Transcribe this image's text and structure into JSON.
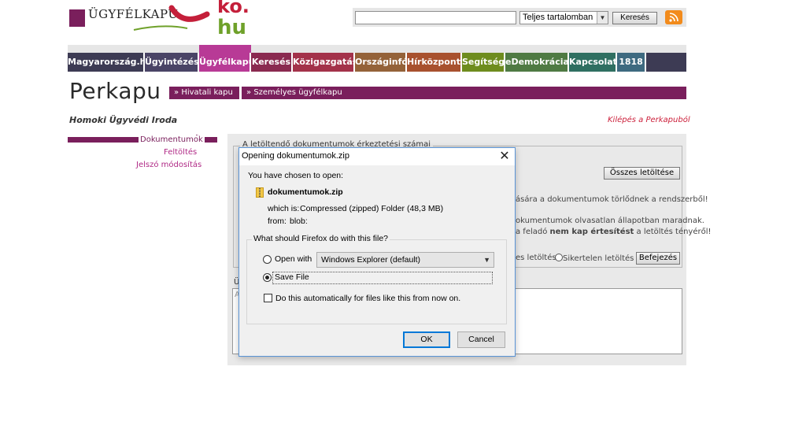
{
  "header": {
    "logo_text": "ÜGYFÉLKAPU",
    "search": {
      "value": "",
      "placeholder": ""
    },
    "scope_select": "Teljes tartalomban",
    "search_button": "Keresés"
  },
  "nav": {
    "items": [
      {
        "label": "Magyarország.hu",
        "color": "#3d3b54"
      },
      {
        "label": "Ügyintézés",
        "color": "#4a4466"
      },
      {
        "label": "Ügyfélkapu",
        "color": "#b83a96"
      },
      {
        "label": "Keresés",
        "color": "#8a2a50"
      },
      {
        "label": "Közigazgatás",
        "color": "#a3324a"
      },
      {
        "label": "Országinfó",
        "color": "#946239"
      },
      {
        "label": "Hírközpont",
        "color": "#a8512e"
      },
      {
        "label": "Segítség",
        "color": "#6e8c1e"
      },
      {
        "label": "eDemokrácia",
        "color": "#4f7a43"
      },
      {
        "label": "Kapcsolat",
        "color": "#2f6f61"
      },
      {
        "label": "1818",
        "color": "#3e6a80"
      }
    ]
  },
  "page": {
    "title": "Perkapu",
    "tabs": [
      "Hivatali kapu",
      "Személyes ügyfélkapu"
    ],
    "org_name": "Homoki Ügyvédi Iroda",
    "logout": "Kilépés a Perkapuból"
  },
  "sidebar": {
    "items": [
      {
        "label": "Dokumentumok",
        "active": true
      },
      {
        "label": "Feltöltés",
        "active": false
      },
      {
        "label": "Jelszó módosítás",
        "active": false
      }
    ]
  },
  "content": {
    "fieldset_legend": "A letöltendő dokumentumok érkeztetési számai",
    "download_all_button": "Összes letöltése",
    "info_line_1": "ására a dokumentumok törlődnek a rendszerből!",
    "info_line_2": "okumentumok olvasatlan állapotban maradnak.",
    "info_line_3_pre": "a feladó ",
    "info_line_3_bold": "nem kap értesítést",
    "info_line_3_post": " a letöltés tényéről!",
    "radio_success": "es letöltés",
    "radio_fail": "Sikertelen letöltés",
    "finish_button": "Befejezés",
    "textarea_label": "Ü",
    "textarea_value": "A"
  },
  "dialog": {
    "title": "Opening dokumentumok.zip",
    "chosen_text": "You have chosen to open:",
    "filename": "dokumentumok.zip",
    "which_is_label": "which is:",
    "which_is_value": "Compressed (zipped) Folder (48,3 MB)",
    "from_label": "from:",
    "from_value": "blob:",
    "question": "What should Firefox do with this file?",
    "open_with_label": "Open with",
    "open_with_app": "Windows Explorer (default)",
    "save_file_label": "Save File",
    "auto_label": "Do this automatically for files like this from now on.",
    "ok_label": "OK",
    "cancel_label": "Cancel",
    "selected_option": "Save File"
  }
}
